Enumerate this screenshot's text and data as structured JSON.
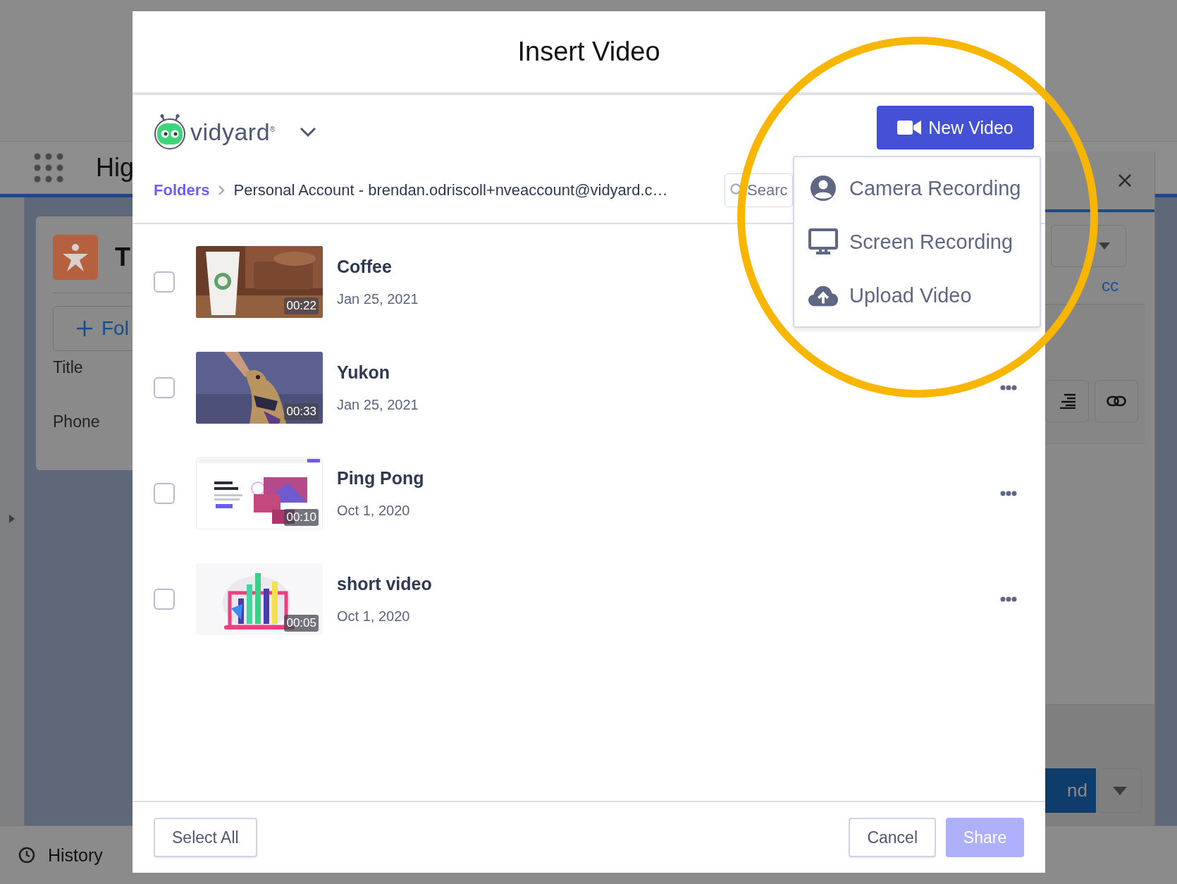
{
  "backdrop": {
    "app_title": "Hig",
    "record_title": "T",
    "follow_button": "Fol",
    "fields": [
      "Title",
      "Phone"
    ],
    "history": "History",
    "panel_links": [
      "cc"
    ],
    "send_button": "nd"
  },
  "modal": {
    "title": "Insert Video",
    "logo": "vidyard$^{®}$",
    "breadcrumb": {
      "root": "Folders",
      "current": "Personal Account - brendan.odriscoll+nveaccount@vidyard.c…"
    },
    "search": {
      "placeholder": "Searc"
    },
    "new_video_button": "New Video",
    "menu": [
      {
        "kind": "camera",
        "label": "Camera Recording"
      },
      {
        "kind": "screen",
        "label": "Screen Recording"
      },
      {
        "kind": "upload",
        "label": "Upload Video"
      }
    ],
    "videos": [
      {
        "title": "Coffee",
        "date": "Jan 25, 2021",
        "duration": "00:22",
        "checked": false,
        "more_button": false
      },
      {
        "title": "Yukon",
        "date": "Jan 25, 2021",
        "duration": "00:33",
        "checked": false,
        "more_button": true
      },
      {
        "title": "Ping Pong",
        "date": "Oct 1, 2020",
        "duration": "00:10",
        "checked": false,
        "more_button": true
      },
      {
        "title": "short video",
        "date": "Oct 1, 2020",
        "duration": "00:05",
        "checked": false,
        "more_button": true
      }
    ],
    "footer": {
      "select_all": "Select All",
      "cancel": "Cancel",
      "share": {
        "label": "Share",
        "disabled": true
      }
    }
  }
}
